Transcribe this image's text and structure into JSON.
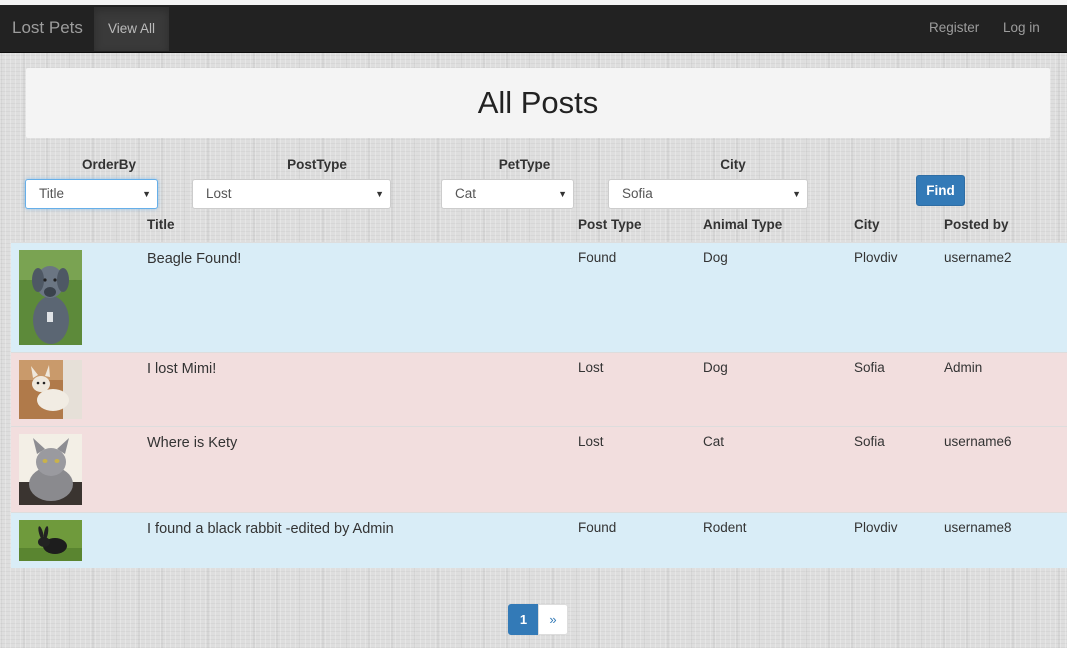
{
  "navbar": {
    "brand": "Lost Pets",
    "view_all": "View All",
    "register": "Register",
    "login": "Log in"
  },
  "page_title": "All Posts",
  "filters": {
    "order_by": {
      "label": "OrderBy",
      "value": "Title"
    },
    "post_type": {
      "label": "PostType",
      "value": "Lost"
    },
    "pet_type": {
      "label": "PetType",
      "value": "Cat"
    },
    "city": {
      "label": "City",
      "value": "Sofia"
    },
    "find_label": "Find"
  },
  "table": {
    "headers": {
      "title": "Title",
      "post_type": "Post Type",
      "animal_type": "Animal Type",
      "city": "City",
      "posted_by": "Posted by"
    },
    "rows": [
      {
        "title": "Beagle Found!",
        "post_type": "Found",
        "animal_type": "Dog",
        "city": "Plovdiv",
        "posted_by": "username2",
        "photo": "grey-puppy-photo"
      },
      {
        "title": "I lost Mimi!",
        "post_type": "Lost",
        "animal_type": "Dog",
        "city": "Sofia",
        "posted_by": "Admin",
        "photo": "chihuahua-photo"
      },
      {
        "title": "Where is Kety",
        "post_type": "Lost",
        "animal_type": "Cat",
        "city": "Sofia",
        "posted_by": "username6",
        "photo": "grey-cat-photo"
      },
      {
        "title": "I found a black rabbit -edited by Admin",
        "post_type": "Found",
        "animal_type": "Rodent",
        "city": "Plovdiv",
        "posted_by": "username8",
        "photo": "black-rabbit-photo"
      }
    ]
  },
  "pagination": {
    "current": "1",
    "next": "»"
  },
  "colors": {
    "navbar": "#222222",
    "primary": "#337ab7",
    "row_info": "#d9edf7",
    "row_danger": "#f2dede"
  }
}
